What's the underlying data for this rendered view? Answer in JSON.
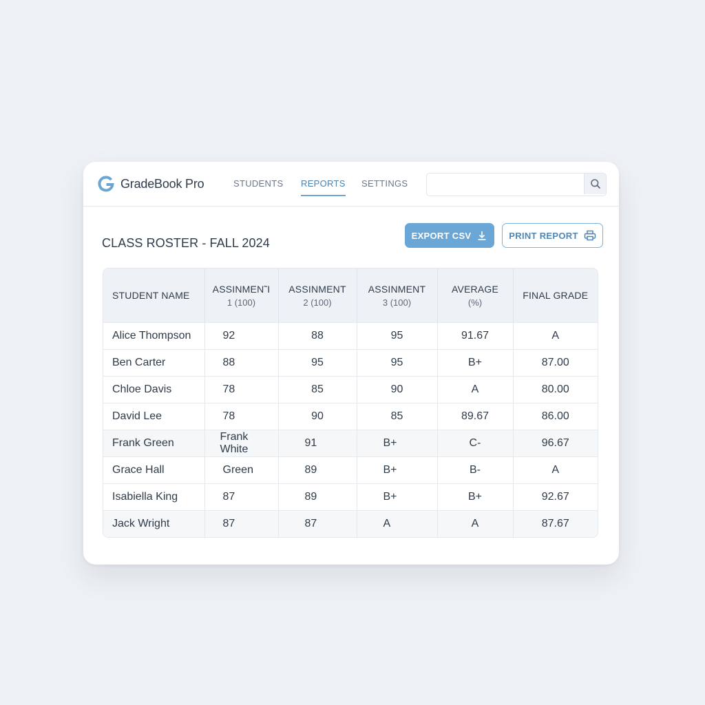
{
  "app": {
    "name": "GradeBook Pro",
    "logo_letter": "G"
  },
  "nav": {
    "tabs": [
      {
        "label": "STUDENTS",
        "active": false
      },
      {
        "label": "REPORTS",
        "active": true
      },
      {
        "label": "SETTINGS",
        "active": false
      }
    ]
  },
  "search": {
    "value": "",
    "placeholder": "",
    "icon": "search-icon"
  },
  "page": {
    "title": "CLASS ROSTER - FALL 2024"
  },
  "toolbar": {
    "export_label": "EXPORT CSV",
    "export_icon": "download-icon",
    "print_label": "PRINT REPORT",
    "print_icon": "printer-icon"
  },
  "colors": {
    "accent": "#6aa7d6",
    "accent_dark": "#4f86b4",
    "background": "#eef1f5"
  },
  "table": {
    "headers": [
      {
        "line1": "STUDENT NAME",
        "line2": ""
      },
      {
        "line1": "ASSINMEN˜I",
        "line2": "1 (100)"
      },
      {
        "line1": "ASSINMENT",
        "line2": "2 (100)"
      },
      {
        "line1": "ASSINMENT",
        "line2": "3 (100)"
      },
      {
        "line1": "AVERAGE",
        "line2": "(%)"
      },
      {
        "line1": "FINAL GRADE",
        "line2": ""
      }
    ],
    "rows": [
      [
        "Alice Thompson",
        "92",
        "88",
        "95",
        "91.67",
        "A"
      ],
      [
        "Ben Carter",
        "88",
        "95",
        "95",
        "B+",
        "87.00"
      ],
      [
        "Chloe Davis",
        "78",
        "85",
        "90",
        "A",
        "80.00"
      ],
      [
        "David Lee",
        "78",
        "90",
        "85",
        "89.67",
        "86.00"
      ],
      [
        "Frank Green",
        "Frank White",
        "91",
        "B+",
        "C-",
        "96.67"
      ],
      [
        "Grace Hall",
        "Green",
        "89",
        "B+",
        "B-",
        "A"
      ],
      [
        "Isabiella King",
        "87",
        "89",
        "B+",
        "B+",
        "92.67"
      ],
      [
        "Jack Wright",
        "87",
        "87",
        "A",
        "A",
        "87.67"
      ]
    ]
  }
}
